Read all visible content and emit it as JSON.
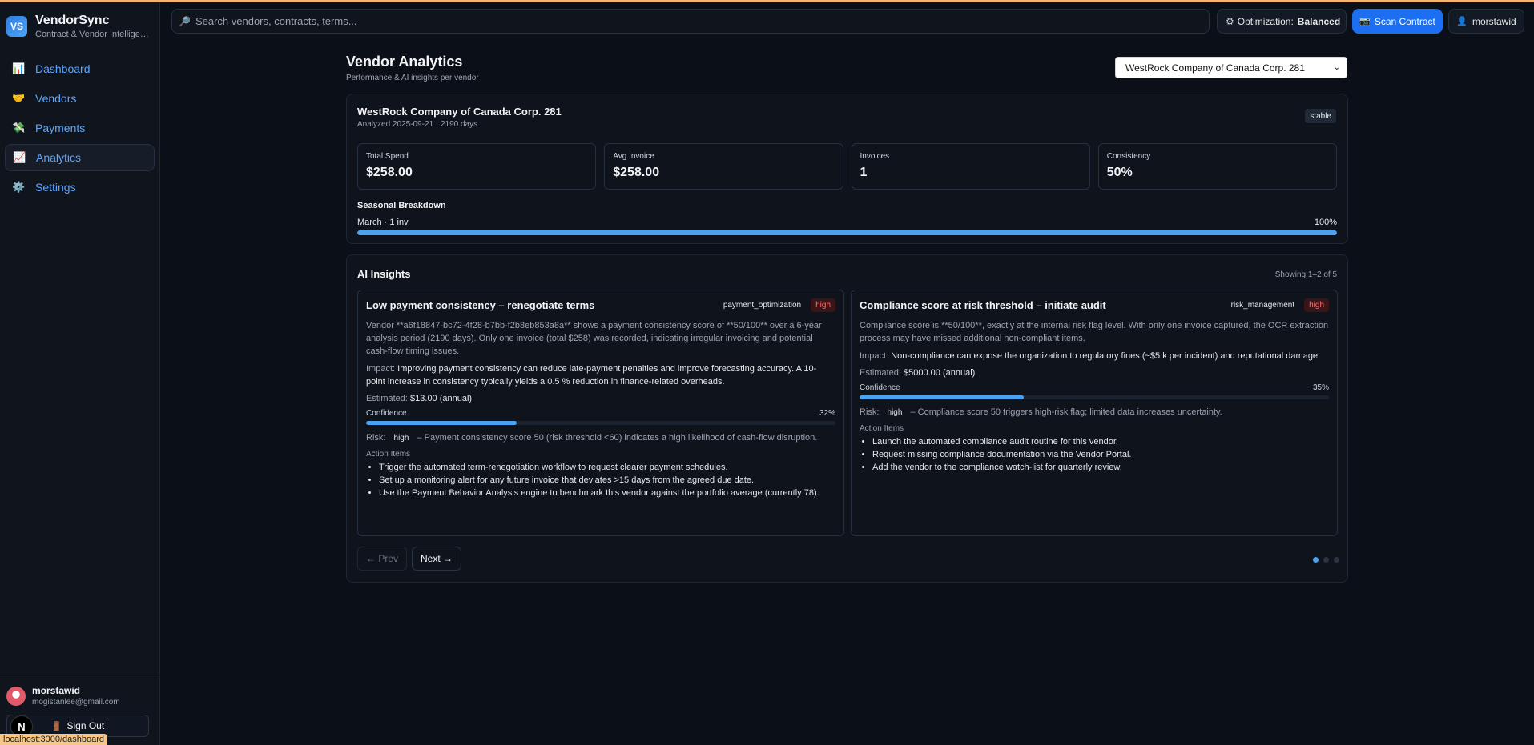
{
  "app": {
    "name": "VendorSync",
    "tagline": "Contract & Vendor Intelligence",
    "logo_text": "VS"
  },
  "nav": [
    {
      "label": "Dashboard",
      "icon": "bar-chart-icon",
      "glyph": "📊"
    },
    {
      "label": "Vendors",
      "icon": "handshake-icon",
      "glyph": "🤝"
    },
    {
      "label": "Payments",
      "icon": "money-icon",
      "glyph": "💸"
    },
    {
      "label": "Analytics",
      "icon": "trend-icon",
      "glyph": "📈",
      "active": true
    },
    {
      "label": "Settings",
      "icon": "gear-icon",
      "glyph": "⚙️"
    }
  ],
  "user": {
    "name": "morstawid",
    "email": "mogistanlee@gmail.com",
    "signout": "Sign Out"
  },
  "dev_badge": "N",
  "status_url": "localhost:3000/dashboard",
  "search": {
    "placeholder": "Search vendors, contracts, terms..."
  },
  "optimization": {
    "label": "Optimization:",
    "value": "Balanced"
  },
  "scan_button": "Scan Contract",
  "user_button": "morstawid",
  "page": {
    "title": "Vendor Analytics",
    "subtitle": "Performance & AI insights per vendor"
  },
  "vendor_select": {
    "selected": "WestRock Company of Canada Corp. 281"
  },
  "vendor": {
    "name": "WestRock Company of Canada Corp. 281",
    "meta": "Analyzed 2025-09-21 · 2190 days",
    "trend": "stable",
    "stats": [
      {
        "label": "Total Spend",
        "value": "$258.00"
      },
      {
        "label": "Avg Invoice",
        "value": "$258.00"
      },
      {
        "label": "Invoices",
        "value": "1"
      },
      {
        "label": "Consistency",
        "value": "50%"
      }
    ],
    "seasonal": {
      "title": "Seasonal Breakdown",
      "rows": [
        {
          "label": "March · 1 inv",
          "percent_text": "100%",
          "percent": 100
        }
      ]
    }
  },
  "insights": {
    "title": "AI Insights",
    "showing": "Showing 1–2 of 5",
    "items": [
      {
        "title": "Low payment consistency – renegotiate terms",
        "category": "payment_optimization",
        "priority": "high",
        "description": "Vendor **a6f18847-bc72-4f28-b7bb-f2b8eb853a8a** shows a payment consistency score of **50/100** over a 6-year analysis period (2190 days). Only one invoice (total $258) was recorded, indicating irregular invoicing and potential cash-flow timing issues.",
        "impact_label": "Impact:",
        "impact": "Improving payment consistency can reduce late-payment penalties and improve forecasting accuracy. A 10-point increase in consistency typically yields a 0.5 % reduction in finance-related overheads.",
        "estimated_label": "Estimated:",
        "estimated": "$13.00 (annual)",
        "confidence_label": "Confidence",
        "confidence_text": "32%",
        "confidence": 32,
        "risk_label": "Risk:",
        "risk_level": "high",
        "risk_text": "– Payment consistency score 50 (risk threshold <60) indicates a high likelihood of cash-flow disruption.",
        "actions_label": "Action Items",
        "actions": [
          "Trigger the automated term-renegotiation workflow to request clearer payment schedules.",
          "Set up a monitoring alert for any future invoice that deviates >15 days from the agreed due date.",
          "Use the Payment Behavior Analysis engine to benchmark this vendor against the portfolio average (currently 78)."
        ]
      },
      {
        "title": "Compliance score at risk threshold – initiate audit",
        "category": "risk_management",
        "priority": "high",
        "description": "Compliance score is **50/100**, exactly at the internal risk flag level. With only one invoice captured, the OCR extraction process may have missed additional non-compliant items.",
        "impact_label": "Impact:",
        "impact": "Non-compliance can expose the organization to regulatory fines (~$5 k per incident) and reputational damage.",
        "estimated_label": "Estimated:",
        "estimated": "$5000.00 (annual)",
        "confidence_label": "Confidence",
        "confidence_text": "35%",
        "confidence": 35,
        "risk_label": "Risk:",
        "risk_level": "high",
        "risk_text": "– Compliance score 50 triggers high-risk flag; limited data increases uncertainty.",
        "actions_label": "Action Items",
        "actions": [
          "Launch the automated compliance audit routine for this vendor.",
          "Request missing compliance documentation via the Vendor Portal.",
          "Add the vendor to the compliance watch-list for quarterly review."
        ]
      }
    ],
    "pager": {
      "prev": "← Prev",
      "next": "Next →",
      "pages": 3,
      "current": 1
    }
  },
  "colors": {
    "accent": "#4aa3f0",
    "primary_button": "#1d6ff2",
    "high_badge": "#f87171",
    "background": "#0b0f17"
  }
}
